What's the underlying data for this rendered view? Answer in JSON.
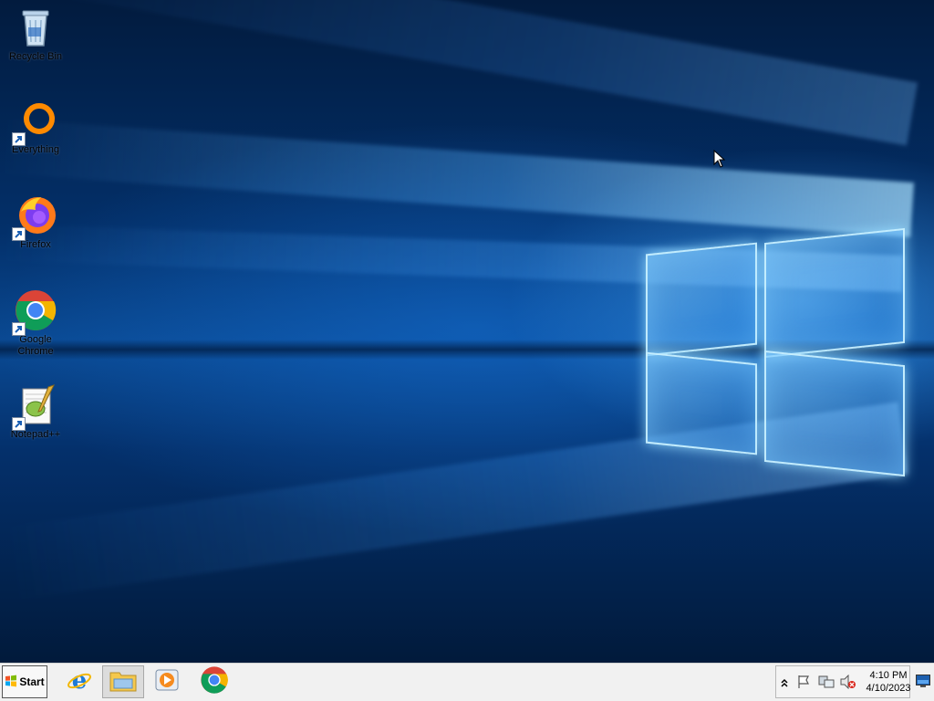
{
  "desktop": {
    "icons": [
      {
        "label": "Recycle Bin",
        "icon": "recycle-bin-icon"
      },
      {
        "label": "Everything",
        "icon": "everything-icon"
      },
      {
        "label": "Firefox",
        "icon": "firefox-icon"
      },
      {
        "label": "Google Chrome",
        "icon": "chrome-icon"
      },
      {
        "label": "Notepad++",
        "icon": "notepad-plus-plus-icon"
      }
    ],
    "wallpaper": "windows-10-hero"
  },
  "taskbar": {
    "start_label": "Start",
    "pinned": [
      {
        "icon": "internet-explorer-icon"
      },
      {
        "icon": "file-explorer-icon",
        "active": true
      },
      {
        "icon": "media-player-icon"
      },
      {
        "icon": "chrome-icon"
      }
    ],
    "tray": {
      "icons": [
        "show-hidden-icons-chevron",
        "action-center-flag-icon",
        "network-icon",
        "volume-muted-icon"
      ],
      "time": "4:10 PM",
      "date": "4/10/2023"
    }
  },
  "colors": {
    "taskbar": "#f1f1f1",
    "wallpaper_blue": "#0a4a94",
    "accent": "#3c9cff"
  }
}
